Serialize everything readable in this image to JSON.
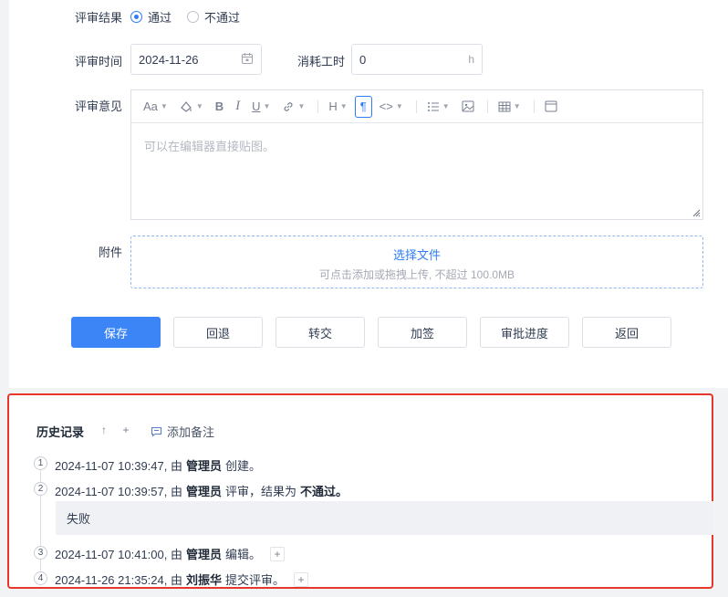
{
  "form": {
    "result_label": "评审结果",
    "result_options": [
      "通过",
      "不通过"
    ],
    "time_label": "评审时间",
    "time_value": "2024-11-26",
    "cost_label": "消耗工时",
    "cost_value": "0",
    "cost_unit": "h",
    "opinion_label": "评审意见",
    "editor_placeholder": "可以在编辑器直接贴图。",
    "toolbar": {
      "font_size": "Aa",
      "bold": "B",
      "italic": "I",
      "underline": "U",
      "heading": "H",
      "paragraph": "¶",
      "code": "<>"
    },
    "attach_label": "附件",
    "upload_pick": "选择文件",
    "upload_hint": "可点击添加或拖拽上传, 不超过 100.0MB"
  },
  "buttons": {
    "save": "保存",
    "back": "回退",
    "transfer": "转交",
    "countersign": "加签",
    "progress": "审批进度",
    "return": "返回"
  },
  "history": {
    "title": "历史记录",
    "add_note": "添加备注",
    "entries": [
      {
        "num": "1",
        "time": "2024-11-07 10:39:47, 由",
        "user": "管理员",
        "action": "创建。",
        "extra": ""
      },
      {
        "num": "2",
        "time": "2024-11-07 10:39:57, 由",
        "user": "管理员",
        "action": "评审，结果为",
        "extra": "不通过。"
      },
      {
        "num": "3",
        "time": "2024-11-07 10:41:00, 由",
        "user": "管理员",
        "action": "编辑。",
        "extra": ""
      },
      {
        "num": "4",
        "time": "2024-11-26 21:35:24, 由",
        "user": "刘振华",
        "action": "提交评审。",
        "extra": ""
      }
    ],
    "comment": "失败"
  }
}
